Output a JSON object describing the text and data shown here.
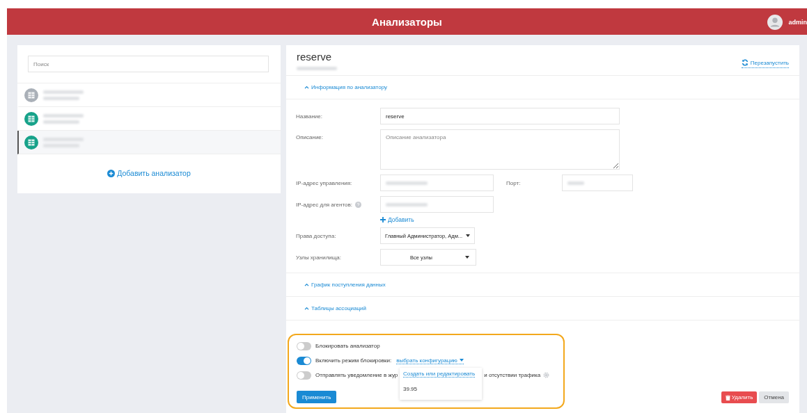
{
  "header": {
    "title": "Анализаторы",
    "user": "admin"
  },
  "sidebar": {
    "search": {
      "placeholder": "Поиск"
    },
    "items": [
      {
        "color": "#aab0b8",
        "selected": false
      },
      {
        "color": "#17a28a",
        "selected": false
      },
      {
        "color": "#17a28a",
        "selected": true
      }
    ],
    "add_button": "Добавить анализатор"
  },
  "detail": {
    "title": "reserve",
    "restart": "Перезапустить",
    "sections": [
      {
        "label": "Информация по анализатору",
        "expanded": true
      },
      {
        "label": "График поступления данных",
        "expanded": true
      },
      {
        "label": "Таблицы ассоциаций",
        "expanded": true
      }
    ],
    "form": {
      "name_label": "Название:",
      "name_value": "reserve",
      "description_label": "Описание:",
      "description_placeholder": "Описание анализатора",
      "ip_label": "IP-адрес управления:",
      "port_label": "Порт:",
      "agents_ip_label": "IP-адрес для агентов:",
      "add_link": "Добавить",
      "access_label": "Права доступа:",
      "access_value": "Главный Администратор, Адм...",
      "storage_label": "Узлы хранилища:",
      "storage_value": "Все узлы"
    },
    "toggles": [
      {
        "label": "Блокировать анализатор",
        "on": false
      },
      {
        "label": "Включить режим блокировки:",
        "on": true,
        "link": "выбрать конфигурацию"
      },
      {
        "label": "Отправлять уведомление в жур",
        "label_after": "и отсутствии трафика",
        "on": false
      }
    ],
    "config_menu": {
      "items": [
        "Создать или редактировать",
        "39.95"
      ]
    },
    "buttons": {
      "apply": "Применить",
      "delete": "Удалить",
      "cancel": "Отмена"
    }
  }
}
